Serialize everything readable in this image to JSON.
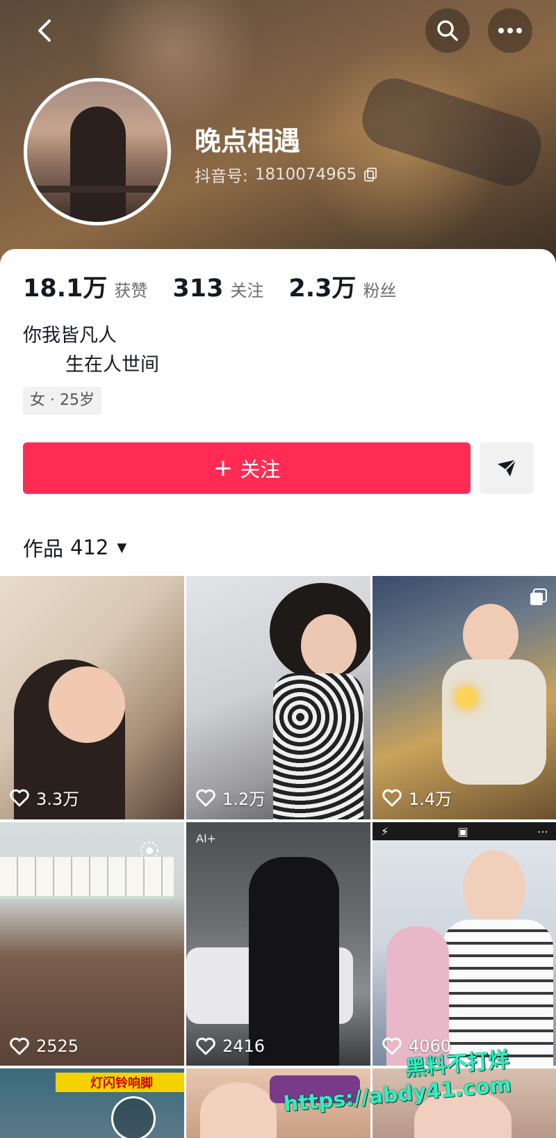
{
  "profile": {
    "username": "晚点相遇",
    "douyin_id_label": "抖音号:",
    "douyin_id": "1810074965",
    "bio_line1": "你我皆凡人",
    "bio_line2": "生在人世间",
    "tag": "女 · 25岁"
  },
  "stats": [
    {
      "value": "18.1万",
      "label": "获赞"
    },
    {
      "value": "313",
      "label": "关注"
    },
    {
      "value": "2.3万",
      "label": "粉丝"
    }
  ],
  "actions": {
    "follow_label": "关注",
    "follow_color": "#fe2c55"
  },
  "works": {
    "label": "作品",
    "count": "412"
  },
  "grid": [
    {
      "likes": "3.3万"
    },
    {
      "likes": "1.2万"
    },
    {
      "likes": "1.4万"
    },
    {
      "likes": "2525"
    },
    {
      "likes": "2416",
      "badge": "AI+"
    },
    {
      "likes": "4060"
    },
    {
      "sign": "灯闪铃响脚"
    },
    {},
    {}
  ],
  "watermark": {
    "line1": "黑料不打烊",
    "line2": "https://abdy41.com"
  }
}
